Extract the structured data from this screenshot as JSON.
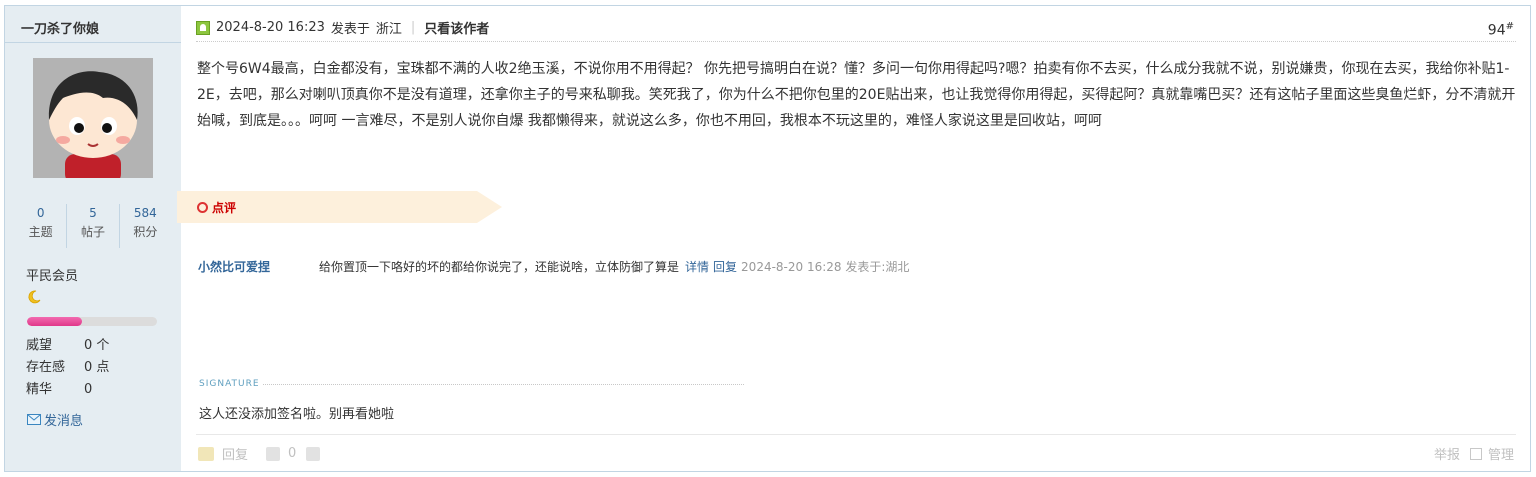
{
  "author": {
    "name": "一刀杀了你娘",
    "stats": [
      {
        "value": "0",
        "label": "主题"
      },
      {
        "value": "5",
        "label": "帖子"
      },
      {
        "value": "584",
        "label": "积分"
      }
    ],
    "group": "平民会员",
    "level_icon": "moon-icon",
    "level_progress": 0.42,
    "info": [
      {
        "label": "威望",
        "value": "0 个"
      },
      {
        "label": "存在感",
        "value": "0 点"
      },
      {
        "label": "精华",
        "value": "0"
      }
    ],
    "send_message": "发消息"
  },
  "post": {
    "date": "2024-8-20 16:23",
    "posted_at_prefix": "发表于",
    "location": "浙江",
    "author_only": "只看该作者",
    "floor": "94",
    "floor_mark": "#",
    "content": "整个号6W4最高，白金都没有，宝珠都不满的人收2绝玉溪，不说你用不用得起？ 你先把号搞明白在说？懂？多问一句你用得起吗?嗯？拍卖有你不去买，什么成分我就不说，别说嫌贵，你现在去买，我给你补贴1-2E，去吧，那么对喇叭顶真你不是没有道理，还拿你主子的号来私聊我。笑死我了，你为什么不把你包里的20E贴出来，也让我觉得你用得起，买得起阿？真就靠嘴巴买？还有这帖子里面这些臭鱼烂虾，分不清就开始喊，到底是。。。呵呵 一言难尽，不是别人说你自爆 我都懒得来，就说这么多，你也不用回，我根本不玩这里的，难怪人家说这里是回收站，呵呵"
  },
  "dianping": {
    "label": "点评",
    "comments": [
      {
        "user": "小然比可爱捏",
        "text": "给你置顶一下咯好的坏的都给你说完了，还能说啥，立体防御了算是",
        "detail": "详情",
        "reply": "回复",
        "time": "2024-8-20 16:28 发表于:湖北"
      }
    ]
  },
  "signature": {
    "title": "SIGNATURE",
    "text": "这人还没添加签名啦。别再看她啦"
  },
  "footer": {
    "reply": "回复",
    "like_count": "0",
    "report": "举报",
    "manage": "管理"
  },
  "colors": {
    "border": "#c2d5e3",
    "sidebar_bg": "#e5edf2",
    "link": "#336699",
    "dianping_bg": "#fdf0dc",
    "progress": "#e0388a"
  }
}
